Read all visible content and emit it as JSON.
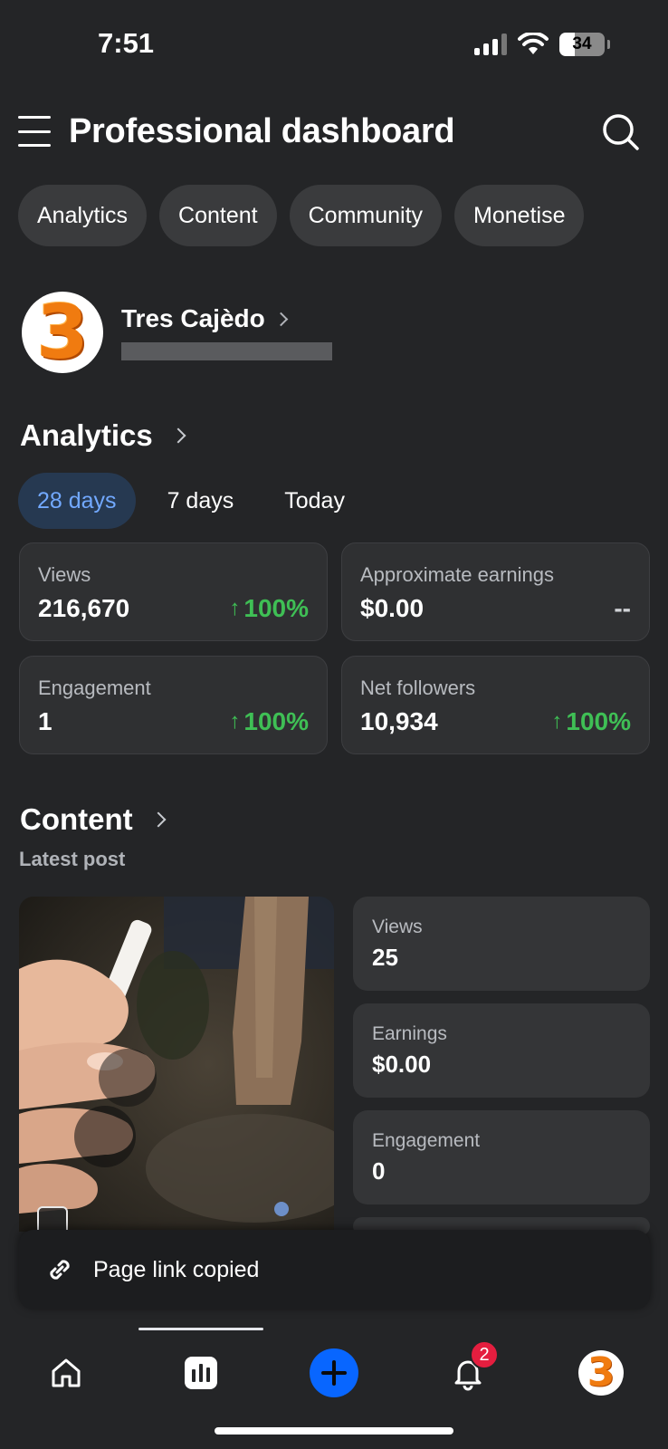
{
  "status_bar": {
    "time": "7:51",
    "battery": "34"
  },
  "header": {
    "title": "Professional dashboard"
  },
  "chips": [
    "Analytics",
    "Content",
    "Community",
    "Monetise"
  ],
  "profile": {
    "name": "Tres Cajèdo",
    "avatar_glyph": "3"
  },
  "analytics": {
    "title": "Analytics",
    "periods": [
      "28 days",
      "7 days",
      "Today"
    ],
    "active_period": "28 days",
    "metrics": [
      {
        "label": "Views",
        "value": "216,670",
        "change": "100%",
        "arrow": "↑"
      },
      {
        "label": "Approximate earnings",
        "value": "$0.00",
        "change": "--",
        "arrow": ""
      },
      {
        "label": "Engagement",
        "value": "1",
        "change": "100%",
        "arrow": "↑"
      },
      {
        "label": "Net followers",
        "value": "10,934",
        "change": "100%",
        "arrow": "↑"
      }
    ]
  },
  "content": {
    "title": "Content",
    "subtitle": "Latest post",
    "post_stats": [
      {
        "label": "Views",
        "value": "25"
      },
      {
        "label": "Earnings",
        "value": "$0.00"
      },
      {
        "label": "Engagement",
        "value": "0"
      }
    ]
  },
  "toast": {
    "text": "Page link copied"
  },
  "bottom_nav": {
    "items": [
      "home-icon",
      "dashboard-icon",
      "create-icon",
      "notifications-icon",
      "profile-avatar"
    ],
    "notification_count": "2",
    "active": "dashboard-icon"
  },
  "colors": {
    "accent": "#0866ff",
    "positive": "#3fbf55",
    "badge": "#e41e3f",
    "background": "#242527",
    "card": "#2f3032"
  }
}
